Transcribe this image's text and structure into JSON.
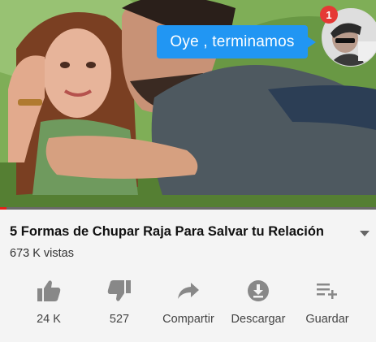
{
  "video": {
    "message_text": "Oye , terminamos",
    "notification_count": "1",
    "progress": 0.017
  },
  "info": {
    "title": "5 Formas de Chupar Raja Para Salvar tu Relación",
    "views": "673 K vistas"
  },
  "actions": [
    {
      "icon": "thumbs-up-icon",
      "label": "24 K"
    },
    {
      "icon": "thumbs-down-icon",
      "label": "527"
    },
    {
      "icon": "share-icon",
      "label": "Compartir"
    },
    {
      "icon": "download-icon",
      "label": "Descargar"
    },
    {
      "icon": "playlist-add-icon",
      "label": "Guardar"
    }
  ],
  "colors": {
    "accent": "#2196f3",
    "progress": "#e62117",
    "badge": "#e53935"
  }
}
